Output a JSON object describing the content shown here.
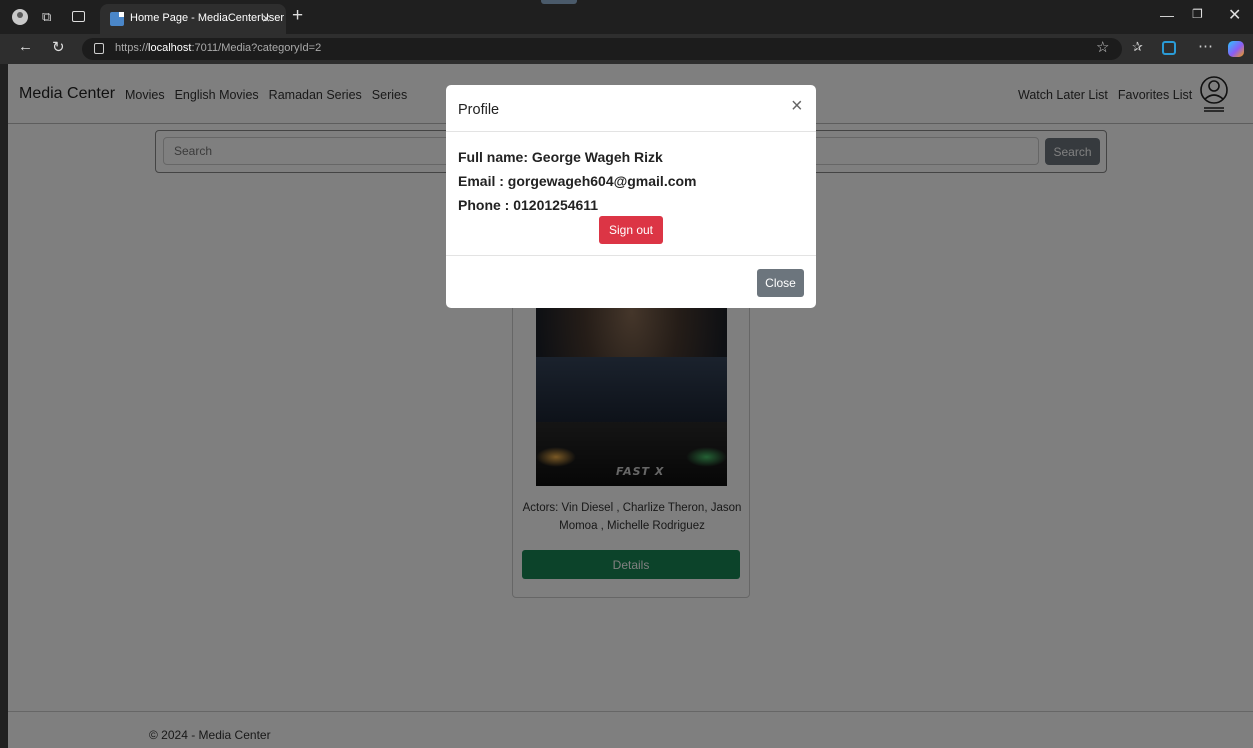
{
  "browser": {
    "tab_title": "Home Page - MediaCenterUser",
    "tab_close": "×",
    "new_tab": "+",
    "url_scheme": "https://",
    "url_host": "localhost",
    "url_rest": ":7011/Media?categoryId=2",
    "back_glyph": "←",
    "refresh_glyph": "↻",
    "star_glyph": "☆",
    "more_glyph": "⋯",
    "favorites_glyph": "✰",
    "window_min": "—",
    "window_max": "❐",
    "window_close": "✕"
  },
  "navbar": {
    "brand": "Media Center",
    "links": [
      "Movies",
      "English Movies",
      "Ramadan Series",
      "Series"
    ],
    "right_links": [
      "Watch Later List",
      "Favorites List"
    ]
  },
  "search": {
    "placeholder": "Search",
    "button_label": "Search"
  },
  "card": {
    "poster_logo": "FAST X",
    "actors": "Actors: Vin Diesel , Charlize Theron, Jason Momoa , Michelle Rodriguez",
    "details_label": "Details"
  },
  "footer": {
    "text": "© 2024 - Media Center"
  },
  "modal": {
    "title": "Profile",
    "close_x": "×",
    "full_name": "Full name: George Wageh Rizk",
    "email": "Email : gorgewageh604@gmail.com",
    "phone": "Phone : 01201254611",
    "signout_label": "Sign out",
    "close_label": "Close"
  },
  "colors": {
    "signout": "#dc3545",
    "details": "#198754",
    "secondary": "#6c757d"
  },
  "icons": [
    "profile-avatar-icon",
    "workspaces-icon",
    "tabs-icon",
    "tab-favicon-icon",
    "lock-icon",
    "star-icon",
    "favorites-icon",
    "extension-icon",
    "more-icon",
    "copilot-icon",
    "user-circle-icon"
  ]
}
